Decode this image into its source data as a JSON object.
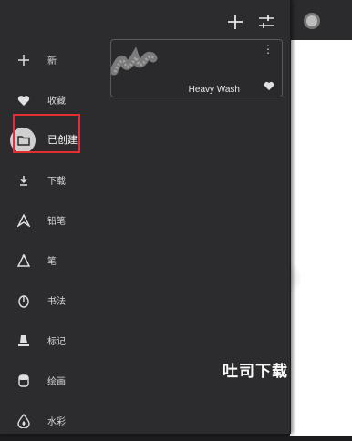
{
  "header": {
    "add_icon": "plus-icon",
    "settings_icon": "tune-icon",
    "color_icon": "color-swatch-icon"
  },
  "sidebar": {
    "items": [
      {
        "label": "新",
        "icon": "plus-icon"
      },
      {
        "label": "收藏",
        "icon": "heart-icon"
      },
      {
        "label": "已创建",
        "icon": "folder-icon",
        "active": true
      },
      {
        "label": "下载",
        "icon": "download-icon"
      },
      {
        "label": "铅笔",
        "icon": "pencil-icon"
      },
      {
        "label": "笔",
        "icon": "pen-icon"
      },
      {
        "label": "书法",
        "icon": "calligraphy-icon"
      },
      {
        "label": "标记",
        "icon": "marker-icon"
      },
      {
        "label": "绘画",
        "icon": "paint-icon"
      },
      {
        "label": "水彩",
        "icon": "watercolor-icon"
      }
    ]
  },
  "brushes": [
    {
      "name": "Heavy Wash",
      "more": "⋮"
    }
  ],
  "watermark": "吐司下载",
  "colors": {
    "panel": "#2c2c2e",
    "highlight": "#e03030",
    "canvas": "#ffffff"
  }
}
